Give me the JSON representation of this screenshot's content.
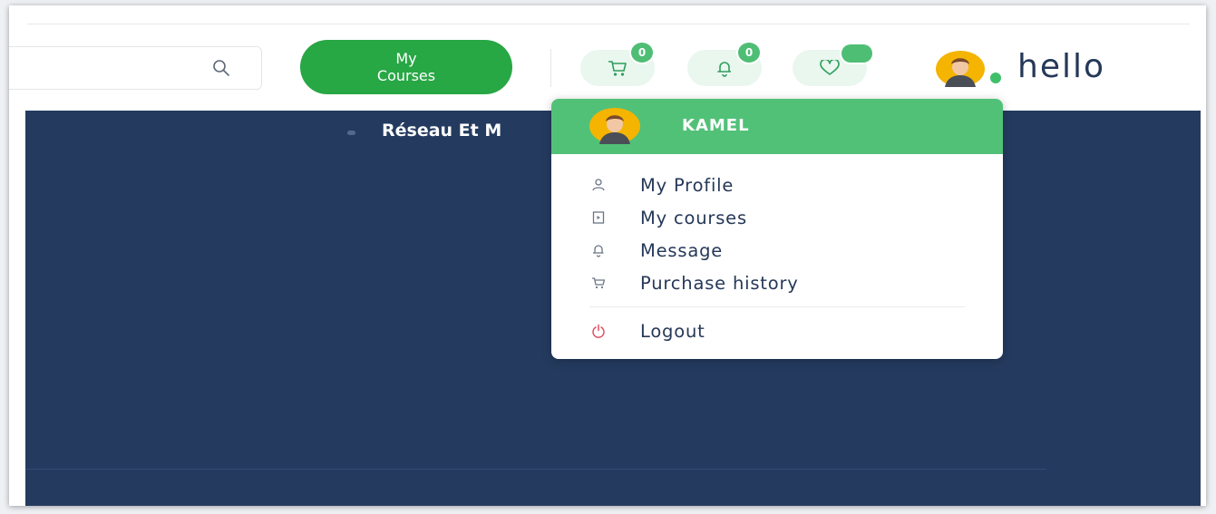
{
  "header": {
    "search": {
      "placeholder": "",
      "value": ""
    },
    "my_courses_label": "My\nCourses",
    "cart_count": "0",
    "notification_count": "0",
    "wishlist_count": "",
    "brand_text": "hello"
  },
  "hero": {
    "title": "Réseau Et M"
  },
  "user_menu": {
    "user_name": "KAMEL",
    "items": [
      {
        "label": "My Profile",
        "icon": "user-icon"
      },
      {
        "label": "My courses",
        "icon": "video-file-icon"
      },
      {
        "label": "Message",
        "icon": "bell-icon"
      },
      {
        "label": "Purchase history",
        "icon": "cart-icon"
      }
    ],
    "logout_label": "Logout"
  },
  "colors": {
    "primary_green": "#28a745",
    "menu_header_green": "#52c178",
    "hero_navy": "#243b5f",
    "text_navy": "#253858",
    "logout_red": "#e0455a"
  }
}
